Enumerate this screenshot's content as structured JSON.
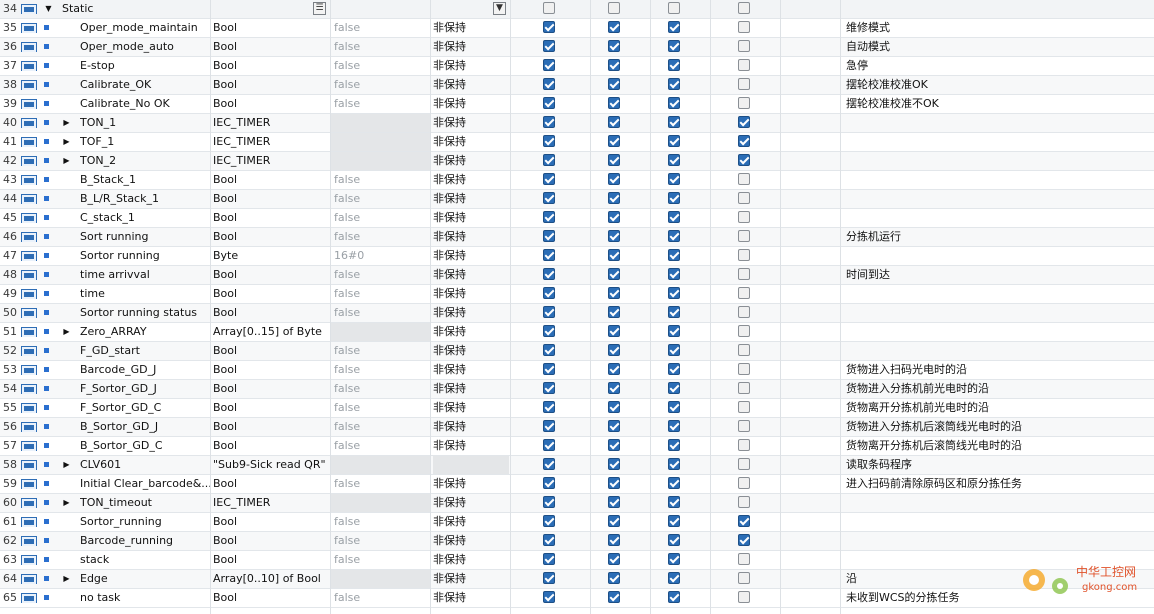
{
  "header": {
    "num": "34",
    "name": "Static",
    "checkboxes": [
      false,
      false,
      false,
      false
    ]
  },
  "rows": [
    {
      "num": "35",
      "name": "Oper_mode_maintain",
      "type": "Bool",
      "default": "false",
      "retain": "非保持",
      "c": [
        true,
        true,
        true,
        false
      ],
      "comment": "维修模式",
      "expand": false
    },
    {
      "num": "36",
      "name": "Oper_mode_auto",
      "type": "Bool",
      "default": "false",
      "retain": "非保持",
      "c": [
        true,
        true,
        true,
        false
      ],
      "comment": "自动模式",
      "expand": false
    },
    {
      "num": "37",
      "name": "E-stop",
      "type": "Bool",
      "default": "false",
      "retain": "非保持",
      "c": [
        true,
        true,
        true,
        false
      ],
      "comment": "急停",
      "expand": false
    },
    {
      "num": "38",
      "name": "Calibrate_OK",
      "type": "Bool",
      "default": "false",
      "retain": "非保持",
      "c": [
        true,
        true,
        true,
        false
      ],
      "comment": "摆轮校准校准OK",
      "expand": false
    },
    {
      "num": "39",
      "name": "Calibrate_No OK",
      "type": "Bool",
      "default": "false",
      "retain": "非保持",
      "c": [
        true,
        true,
        true,
        false
      ],
      "comment": "摆轮校准校准不OK",
      "expand": false
    },
    {
      "num": "40",
      "name": "TON_1",
      "type": "IEC_TIMER",
      "default": "",
      "retain": "非保持",
      "c": [
        true,
        true,
        true,
        true
      ],
      "comment": "",
      "expand": true
    },
    {
      "num": "41",
      "name": "TOF_1",
      "type": "IEC_TIMER",
      "default": "",
      "retain": "非保持",
      "c": [
        true,
        true,
        true,
        true
      ],
      "comment": "",
      "expand": true
    },
    {
      "num": "42",
      "name": "TON_2",
      "type": "IEC_TIMER",
      "default": "",
      "retain": "非保持",
      "c": [
        true,
        true,
        true,
        true
      ],
      "comment": "",
      "expand": true
    },
    {
      "num": "43",
      "name": "B_Stack_1",
      "type": "Bool",
      "default": "false",
      "retain": "非保持",
      "c": [
        true,
        true,
        true,
        false
      ],
      "comment": "",
      "expand": false
    },
    {
      "num": "44",
      "name": "B_L/R_Stack_1",
      "type": "Bool",
      "default": "false",
      "retain": "非保持",
      "c": [
        true,
        true,
        true,
        false
      ],
      "comment": "",
      "expand": false
    },
    {
      "num": "45",
      "name": "C_stack_1",
      "type": "Bool",
      "default": "false",
      "retain": "非保持",
      "c": [
        true,
        true,
        true,
        false
      ],
      "comment": "",
      "expand": false
    },
    {
      "num": "46",
      "name": "Sort running",
      "type": "Bool",
      "default": "false",
      "retain": "非保持",
      "c": [
        true,
        true,
        true,
        false
      ],
      "comment": "分拣机运行",
      "expand": false
    },
    {
      "num": "47",
      "name": "Sortor running",
      "type": "Byte",
      "default": "16#0",
      "retain": "非保持",
      "c": [
        true,
        true,
        true,
        false
      ],
      "comment": "",
      "expand": false
    },
    {
      "num": "48",
      "name": "time arrivval",
      "type": "Bool",
      "default": "false",
      "retain": "非保持",
      "c": [
        true,
        true,
        true,
        false
      ],
      "comment": "时间到达",
      "expand": false
    },
    {
      "num": "49",
      "name": "time",
      "type": "Bool",
      "default": "false",
      "retain": "非保持",
      "c": [
        true,
        true,
        true,
        false
      ],
      "comment": "",
      "expand": false
    },
    {
      "num": "50",
      "name": "Sortor running status",
      "type": "Bool",
      "default": "false",
      "retain": "非保持",
      "c": [
        true,
        true,
        true,
        false
      ],
      "comment": "",
      "expand": false
    },
    {
      "num": "51",
      "name": "Zero_ARRAY",
      "type": "Array[0..15] of Byte",
      "default": "",
      "retain": "非保持",
      "c": [
        true,
        true,
        true,
        false
      ],
      "comment": "",
      "expand": true
    },
    {
      "num": "52",
      "name": "F_GD_start",
      "type": "Bool",
      "default": "false",
      "retain": "非保持",
      "c": [
        true,
        true,
        true,
        false
      ],
      "comment": "",
      "expand": false
    },
    {
      "num": "53",
      "name": "Barcode_GD_J",
      "type": "Bool",
      "default": "false",
      "retain": "非保持",
      "c": [
        true,
        true,
        true,
        false
      ],
      "comment": "货物进入扫码光电时的沿",
      "expand": false
    },
    {
      "num": "54",
      "name": "F_Sortor_GD_J",
      "type": "Bool",
      "default": "false",
      "retain": "非保持",
      "c": [
        true,
        true,
        true,
        false
      ],
      "comment": "货物进入分拣机前光电时的沿",
      "expand": false
    },
    {
      "num": "55",
      "name": "F_Sortor_GD_C",
      "type": "Bool",
      "default": "false",
      "retain": "非保持",
      "c": [
        true,
        true,
        true,
        false
      ],
      "comment": "货物离开分拣机前光电时的沿",
      "expand": false
    },
    {
      "num": "56",
      "name": "B_Sortor_GD_J",
      "type": "Bool",
      "default": "false",
      "retain": "非保持",
      "c": [
        true,
        true,
        true,
        false
      ],
      "comment": "货物进入分拣机后滚筒线光电时的沿",
      "expand": false
    },
    {
      "num": "57",
      "name": "B_Sortor_GD_C",
      "type": "Bool",
      "default": "false",
      "retain": "非保持",
      "c": [
        true,
        true,
        true,
        false
      ],
      "comment": "货物离开分拣机后滚筒线光电时的沿",
      "expand": false
    },
    {
      "num": "58",
      "name": "CLV601",
      "type": "\"Sub9-Sick read QR\"",
      "default": "",
      "retain": "",
      "c": [
        true,
        true,
        true,
        false
      ],
      "comment": "读取条码程序",
      "expand": true
    },
    {
      "num": "59",
      "name": "Initial Clear_barcode&...",
      "type": "Bool",
      "default": "false",
      "retain": "非保持",
      "c": [
        true,
        true,
        true,
        false
      ],
      "comment": "进入扫码前清除原码区和原分拣任务",
      "expand": false
    },
    {
      "num": "60",
      "name": "TON_timeout",
      "type": "IEC_TIMER",
      "default": "",
      "retain": "非保持",
      "c": [
        true,
        true,
        true,
        false
      ],
      "comment": "",
      "expand": true
    },
    {
      "num": "61",
      "name": "Sortor_running",
      "type": "Bool",
      "default": "false",
      "retain": "非保持",
      "c": [
        true,
        true,
        true,
        true
      ],
      "comment": "",
      "expand": false
    },
    {
      "num": "62",
      "name": "Barcode_running",
      "type": "Bool",
      "default": "false",
      "retain": "非保持",
      "c": [
        true,
        true,
        true,
        true
      ],
      "comment": "",
      "expand": false
    },
    {
      "num": "63",
      "name": "stack",
      "type": "Bool",
      "default": "false",
      "retain": "非保持",
      "c": [
        true,
        true,
        true,
        false
      ],
      "comment": "",
      "expand": false
    },
    {
      "num": "64",
      "name": "Edge",
      "type": "Array[0..10] of Bool",
      "default": "",
      "retain": "非保持",
      "c": [
        true,
        true,
        true,
        false
      ],
      "comment": "沿",
      "expand": true
    },
    {
      "num": "65",
      "name": "no task",
      "type": "Bool",
      "default": "false",
      "retain": "非保持",
      "c": [
        true,
        true,
        true,
        false
      ],
      "comment": "未收到WCS的分拣任务",
      "expand": false
    }
  ],
  "watermark": {
    "text": "中华工控网",
    "url": "gkong.com"
  }
}
